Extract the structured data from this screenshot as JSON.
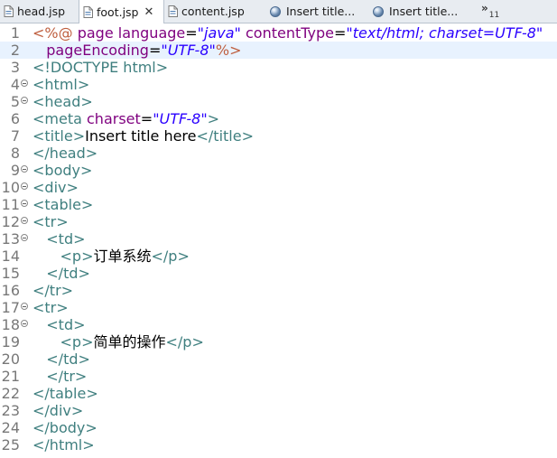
{
  "tabs": [
    {
      "label": "head.jsp",
      "icon": "jsp-file-icon",
      "active": false
    },
    {
      "label": "foot.jsp",
      "icon": "jsp-file-icon",
      "active": true,
      "close": "✕"
    },
    {
      "label": "content.jsp",
      "icon": "jsp-file-icon",
      "active": false
    },
    {
      "label": "Insert title...",
      "icon": "browser-globe-icon",
      "active": false
    },
    {
      "label": "Insert title...",
      "icon": "browser-globe-icon",
      "active": false
    }
  ],
  "overflow": {
    "symbol": "»",
    "count": "11"
  },
  "editor": {
    "current_line": 2,
    "line_numbers": [
      "1",
      "2",
      "3",
      "4",
      "5",
      "6",
      "7",
      "8",
      "9",
      "10",
      "11",
      "12",
      "13",
      "14",
      "15",
      "16",
      "17",
      "18",
      "19",
      "20",
      "21",
      "22",
      "23",
      "24",
      "25"
    ],
    "lines": [
      [
        {
          "c": "d",
          "t": "<%@ "
        },
        {
          "c": "a",
          "t": "page "
        },
        {
          "c": "a",
          "t": "language"
        },
        {
          "c": "x",
          "t": "="
        },
        {
          "c": "v",
          "t": "\"java\""
        },
        {
          "c": "x",
          "t": " "
        },
        {
          "c": "a",
          "t": "contentType"
        },
        {
          "c": "x",
          "t": "="
        },
        {
          "c": "v",
          "t": "\"text/html; charset=UTF-8\""
        }
      ],
      [
        {
          "c": "x",
          "t": "   "
        },
        {
          "c": "a",
          "t": "pageEncoding"
        },
        {
          "c": "x",
          "t": "="
        },
        {
          "c": "v",
          "t": "\"UTF-8\""
        },
        {
          "c": "d",
          "t": "%>"
        }
      ],
      [
        {
          "c": "t",
          "t": "<!DOCTYPE html>"
        }
      ],
      [
        {
          "c": "t",
          "t": "<html>"
        }
      ],
      [
        {
          "c": "t",
          "t": "<head>"
        }
      ],
      [
        {
          "c": "t",
          "t": "<meta "
        },
        {
          "c": "a",
          "t": "charset"
        },
        {
          "c": "x",
          "t": "="
        },
        {
          "c": "v",
          "t": "\"UTF-8\""
        },
        {
          "c": "t",
          "t": ">"
        }
      ],
      [
        {
          "c": "t",
          "t": "<title>"
        },
        {
          "c": "x",
          "t": "Insert title here"
        },
        {
          "c": "t",
          "t": "</title>"
        }
      ],
      [
        {
          "c": "t",
          "t": "</head>"
        }
      ],
      [
        {
          "c": "t",
          "t": "<body>"
        }
      ],
      [
        {
          "c": "t",
          "t": "<div>"
        }
      ],
      [
        {
          "c": "t",
          "t": "<table>"
        }
      ],
      [
        {
          "c": "t",
          "t": "<tr>"
        }
      ],
      [
        {
          "c": "x",
          "t": "   "
        },
        {
          "c": "t",
          "t": "<td>"
        }
      ],
      [
        {
          "c": "x",
          "t": "      "
        },
        {
          "c": "t",
          "t": "<p>"
        },
        {
          "c": "x",
          "t": "订单系统"
        },
        {
          "c": "t",
          "t": "</p>"
        }
      ],
      [
        {
          "c": "x",
          "t": "   "
        },
        {
          "c": "t",
          "t": "</td>"
        }
      ],
      [
        {
          "c": "t",
          "t": "</tr>"
        }
      ],
      [
        {
          "c": "t",
          "t": "<tr>"
        }
      ],
      [
        {
          "c": "x",
          "t": "   "
        },
        {
          "c": "t",
          "t": "<td>"
        }
      ],
      [
        {
          "c": "x",
          "t": "      "
        },
        {
          "c": "t",
          "t": "<p>"
        },
        {
          "c": "x",
          "t": "简单的操作"
        },
        {
          "c": "t",
          "t": "</p>"
        }
      ],
      [
        {
          "c": "x",
          "t": "   "
        },
        {
          "c": "t",
          "t": "</td>"
        }
      ],
      [
        {
          "c": "x",
          "t": "   "
        },
        {
          "c": "t",
          "t": "</tr>"
        }
      ],
      [
        {
          "c": "t",
          "t": "</table>"
        }
      ],
      [
        {
          "c": "t",
          "t": "</div>"
        }
      ],
      [
        {
          "c": "t",
          "t": "</body>"
        }
      ],
      [
        {
          "c": "t",
          "t": "</html>"
        }
      ]
    ],
    "folded_lines": [
      4,
      5,
      9,
      10,
      11,
      12,
      13,
      17,
      18
    ]
  },
  "colors": {
    "tag": "#3f7f7f",
    "directive": "#bf5f3f",
    "attribute": "#7f007f",
    "value": "#2a00ff",
    "current_line_bg": "#e8f2fe"
  }
}
